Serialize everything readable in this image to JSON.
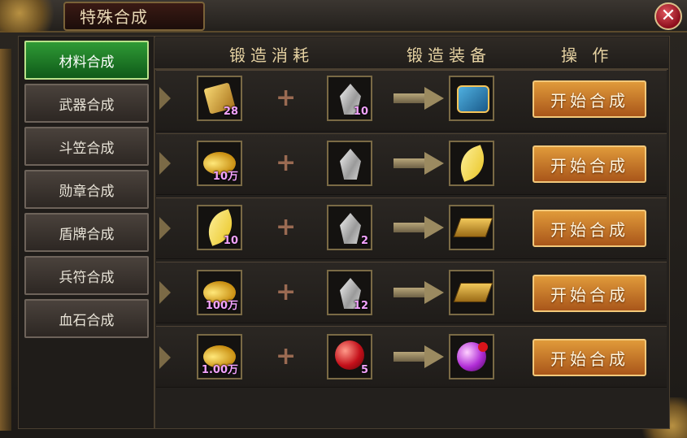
{
  "window": {
    "title": "特殊合成",
    "close_icon": "close-icon"
  },
  "sidebar": {
    "items": [
      {
        "label": "材料合成",
        "active": true
      },
      {
        "label": "武器合成",
        "active": false
      },
      {
        "label": "斗笠合成",
        "active": false
      },
      {
        "label": "勋章合成",
        "active": false
      },
      {
        "label": "盾牌合成",
        "active": false
      },
      {
        "label": "兵符合成",
        "active": false
      },
      {
        "label": "血石合成",
        "active": false
      }
    ]
  },
  "table": {
    "headers": [
      "锻造消耗",
      "锻造装备",
      "操 作"
    ],
    "rows": [
      {
        "cost1": {
          "icon": "gold-bars-icon",
          "qty": "28"
        },
        "cost2": {
          "icon": "crystal-icon",
          "qty": "10"
        },
        "result": {
          "icon": "scroll-icon"
        },
        "action": "开始合成"
      },
      {
        "cost1": {
          "icon": "gold-coins-icon",
          "qty": "10万"
        },
        "cost2": {
          "icon": "crystal-icon",
          "qty": ""
        },
        "result": {
          "icon": "golden-leaf-icon"
        },
        "action": "开始合成"
      },
      {
        "cost1": {
          "icon": "golden-leaf-icon",
          "qty": "10"
        },
        "cost2": {
          "icon": "crystal-icon",
          "qty": "2"
        },
        "result": {
          "icon": "gold-ingot-icon"
        },
        "action": "开始合成"
      },
      {
        "cost1": {
          "icon": "gold-coins-icon",
          "qty": "100万"
        },
        "cost2": {
          "icon": "crystal-icon",
          "qty": "12"
        },
        "result": {
          "icon": "gold-ingot-icon"
        },
        "action": "开始合成"
      },
      {
        "cost1": {
          "icon": "gold-coins-icon",
          "qty": "1.00万"
        },
        "cost2": {
          "icon": "red-orb-icon",
          "qty": "5"
        },
        "result": {
          "icon": "purple-orb-icon"
        },
        "action": "开始合成"
      }
    ],
    "plus_symbol": "+"
  },
  "colors": {
    "active_tab": "#2f9a35",
    "craft_button": "#e09a3a",
    "quantity_text": "#f3a3ff",
    "header_text": "#e6d2a2"
  }
}
